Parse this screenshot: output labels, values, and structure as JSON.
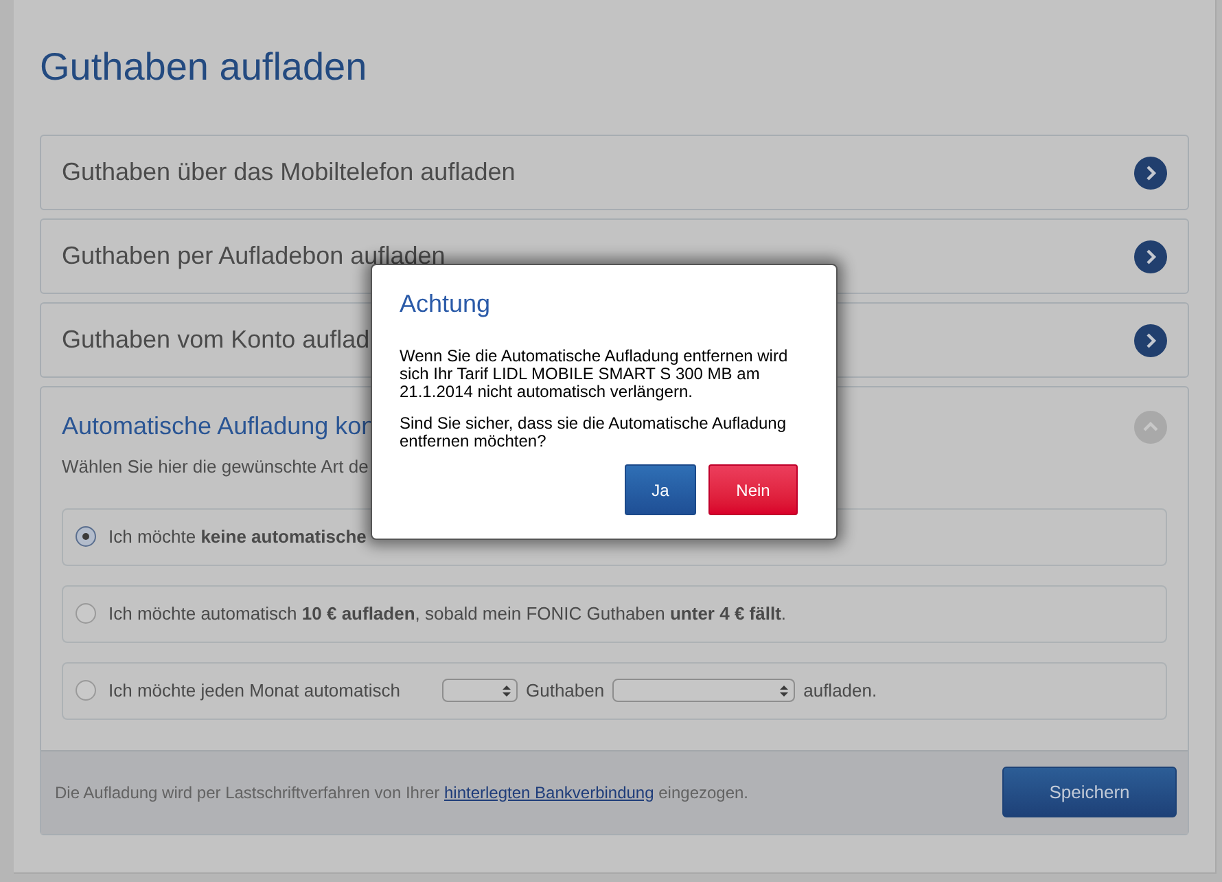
{
  "page_title": "Guthaben aufladen",
  "sections": [
    {
      "title": "Guthaben über das Mobiltelefon aufladen",
      "expanded": false
    },
    {
      "title": "Guthaben per Aufladebon aufladen",
      "expanded": false
    },
    {
      "title": "Guthaben vom Konto auflad",
      "expanded": false
    }
  ],
  "auto_section": {
    "title": "Automatische Aufladung kon",
    "expanded": true,
    "description": "Wählen Sie hier die gewünschte Art de",
    "options": [
      {
        "kind": "text",
        "text": "Ich möchte **keine automatische**",
        "selected": true
      },
      {
        "kind": "text",
        "text": "Ich möchte automatisch **10 € aufladen**, sobald mein FONIC Guthaben **unter 4 € fällt**.",
        "selected": false
      },
      {
        "kind": "monthly",
        "before": "Ich möchte jeden Monat automatisch",
        "middle": "Guthaben",
        "after": "aufladen.",
        "selected": false
      }
    ],
    "footer": {
      "text_before": "Die Aufladung wird per Lastschriftverfahren von Ihrer",
      "link": "hinterlegten Bankverbindung",
      "text_after": "eingezogen."
    },
    "save_button": "Speichern"
  },
  "dialog": {
    "title": "Achtung",
    "paragraphs": [
      "Wenn Sie die Automatische Aufladung entfernen wird sich Ihr Tarif LIDL MOBILE SMART S 300 MB am 21.1.2014 nicht automatisch verlängern.",
      "Sind Sie sicher, dass sie die Automatische Aufladung entfernen möchten?"
    ],
    "buttons": [
      {
        "label": "Ja",
        "kind": "confirm"
      },
      {
        "label": "Nein",
        "kind": "cancel"
      }
    ]
  }
}
